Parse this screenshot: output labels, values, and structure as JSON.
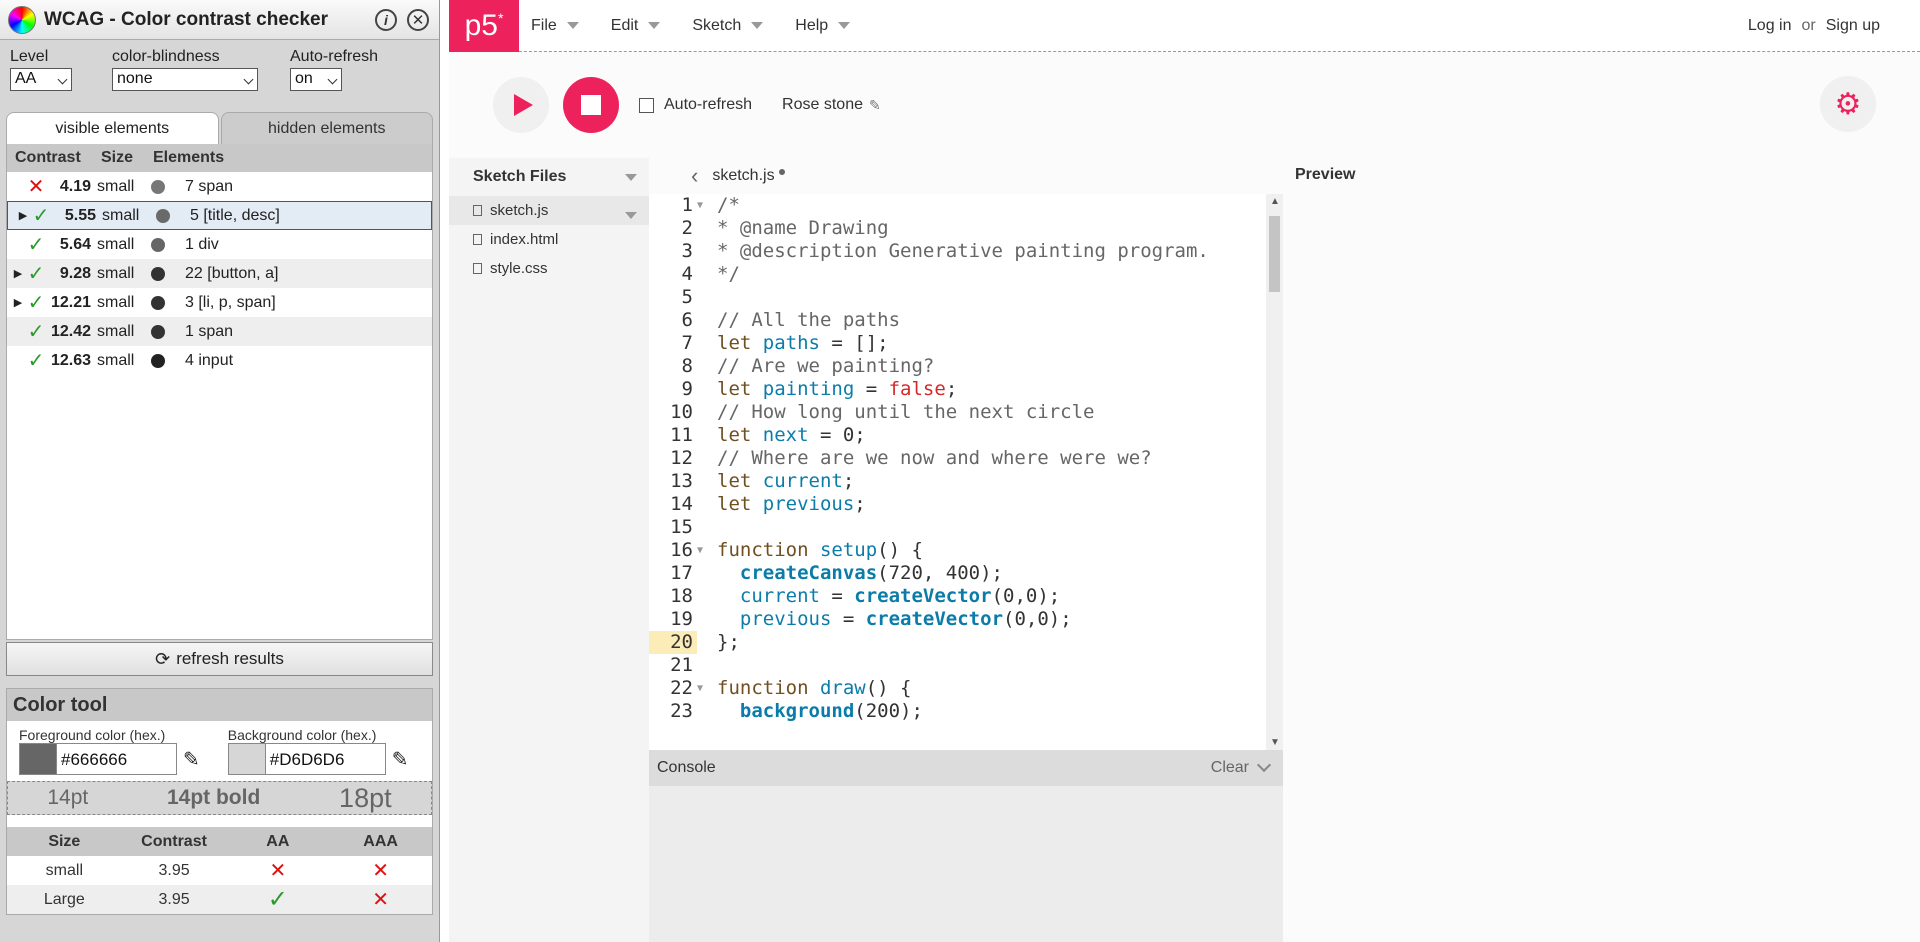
{
  "wcag": {
    "title": "WCAG - Color contrast checker",
    "level": {
      "label": "Level",
      "value": "AA"
    },
    "colorblind": {
      "label": "color-blindness",
      "value": "none"
    },
    "autorefresh": {
      "label": "Auto-refresh",
      "value": "on"
    },
    "tabs": [
      "visible elements",
      "hidden elements"
    ],
    "headers": {
      "contrast": "Contrast",
      "size": "Size",
      "elements": "Elements"
    },
    "rows": [
      {
        "status": "fail",
        "ratio": "4.19",
        "size": "small",
        "dot": "#777777",
        "elements": "7 span"
      },
      {
        "status": "pass",
        "ratio": "5.55",
        "size": "small",
        "dot": "#6a6a6a",
        "elements": "5 [title, desc]"
      },
      {
        "status": "pass",
        "ratio": "5.64",
        "size": "small",
        "dot": "#666666",
        "elements": "1 div"
      },
      {
        "status": "pass",
        "ratio": "9.28",
        "size": "small",
        "dot": "#333333",
        "elements": "22 [button, a]"
      },
      {
        "status": "pass",
        "ratio": "12.21",
        "size": "small",
        "dot": "#333333",
        "elements": "3 [li, p, span]"
      },
      {
        "status": "pass",
        "ratio": "12.42",
        "size": "small",
        "dot": "#333333",
        "elements": "1 span"
      },
      {
        "status": "pass",
        "ratio": "12.63",
        "size": "small",
        "dot": "#222222",
        "elements": "4 input"
      }
    ],
    "refresh": "refresh results",
    "colortool": {
      "title": "Color tool",
      "fg_label": "Foreground color (hex.)",
      "fg_value": "#666666",
      "bg_label": "Background color (hex.)",
      "bg_value": "#D6D6D6",
      "preview": [
        "14pt",
        "14pt bold",
        "18pt"
      ],
      "table_headers": [
        "Size",
        "Contrast",
        "AA",
        "AAA"
      ],
      "table_rows": [
        {
          "size": "small",
          "contrast": "3.95",
          "aa": "fail",
          "aaa": "fail"
        },
        {
          "size": "Large",
          "contrast": "3.95",
          "aa": "pass",
          "aaa": "fail"
        }
      ]
    }
  },
  "p5": {
    "logo": "p5",
    "menu": [
      "File",
      "Edit",
      "Sketch",
      "Help"
    ],
    "login": "Log in",
    "or": "or",
    "signup": "Sign up",
    "autorefresh": "Auto-refresh",
    "sketch_name": "Rose stone",
    "sketch_files": "Sketch Files",
    "files": [
      "sketch.js",
      "index.html",
      "style.css"
    ],
    "tab": "sketch.js",
    "preview": "Preview",
    "console": "Console",
    "clear": "Clear",
    "highlight_line": 20
  }
}
